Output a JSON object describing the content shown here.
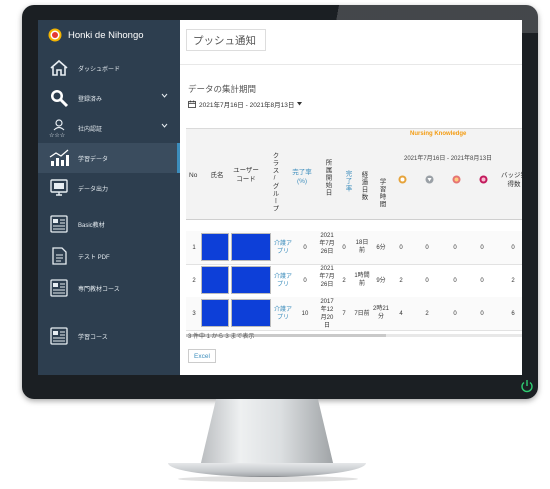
{
  "app": {
    "brand": "Honki de Nihongo",
    "page_title": "プッシュ通知"
  },
  "sidebar": {
    "items": [
      {
        "label": "ダッシュボード",
        "icon": "home-icon"
      },
      {
        "label": "登録済み",
        "icon": "search-icon"
      },
      {
        "label": "社内認証",
        "icon": "users-icon"
      },
      {
        "label": "学習データ",
        "icon": "chart-icon"
      },
      {
        "label": "データ出力",
        "icon": "monitor-icon"
      },
      {
        "label": "Basic教材",
        "icon": "book-icon"
      },
      {
        "label": "テスト PDF",
        "icon": "pdf-icon"
      },
      {
        "label": "専門教材コース",
        "icon": "book-icon"
      },
      {
        "label": "学習コース",
        "icon": "book-icon"
      }
    ]
  },
  "period": {
    "title": "データの集計期間",
    "range": "2021年7月16日 - 2021年8月13日"
  },
  "table": {
    "group_label": "Nursing Knowledge",
    "group_range": "2021年7月16日 - 2021年8月13日",
    "headers": {
      "no": "No",
      "name": "氏名",
      "user_code": "ユーザーコード",
      "class_group": "クラス/グループ",
      "completion_rate": "完了率(%)",
      "enroll_date": "所属開始日",
      "done_rate": "完了率",
      "period_days": "経過日数",
      "study_time": "学習時間",
      "badge": "バッジ獲得数"
    },
    "rows": [
      {
        "no": "1",
        "class": "介護アプリ",
        "rate": "0",
        "start": "2021年7月26日",
        "done": "0",
        "days": "18日前",
        "time": "6分",
        "b1": "0",
        "b2": "0",
        "b3": "0",
        "b4": "0",
        "badges": "0"
      },
      {
        "no": "2",
        "class": "介護アプリ",
        "rate": "0",
        "start": "2021年7月26日",
        "done": "2",
        "days": "1時間前",
        "time": "9分",
        "b1": "2",
        "b2": "0",
        "b3": "0",
        "b4": "0",
        "badges": "2"
      },
      {
        "no": "3",
        "class": "介護アプリ",
        "rate": "10",
        "start": "2017年12月20日",
        "done": "7",
        "days": "7日前",
        "time": "2時21分",
        "b1": "4",
        "b2": "2",
        "b3": "0",
        "b4": "0",
        "badges": "6"
      }
    ],
    "footer": "3 件中 1 から 3 まで表示",
    "excel_label": "Excel"
  },
  "colors": {
    "sidebar_bg": "#2d3e4f",
    "accent": "#3c8dbc",
    "nursing_label": "#f39c12",
    "redaction": "#0d3fd8"
  }
}
